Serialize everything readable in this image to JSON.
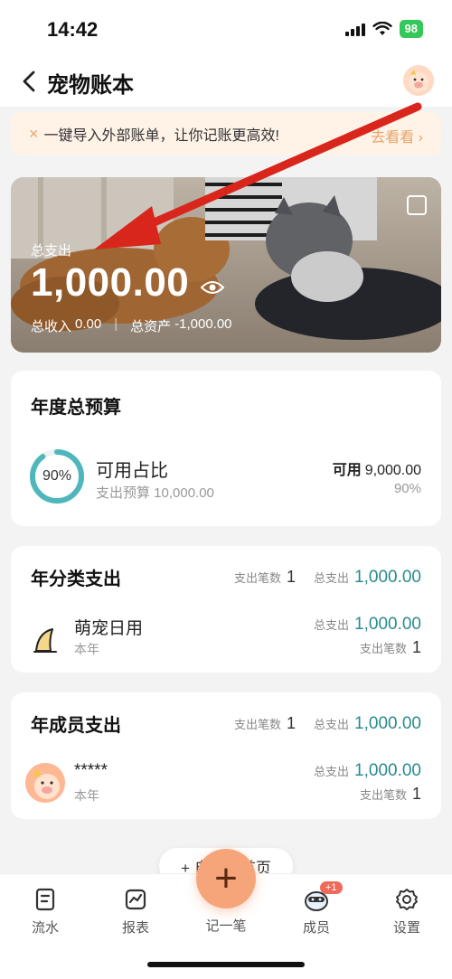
{
  "status": {
    "time": "14:42",
    "battery": "98"
  },
  "header": {
    "title": "宠物账本"
  },
  "import_banner": {
    "close": "×",
    "text": "一键导入外部账单，让你记账更高效!",
    "link": "去看看 ›"
  },
  "hero": {
    "label": "总支出",
    "amount": "1,000.00",
    "income_label": "总收入",
    "income_value": "0.00",
    "assets_label": "总资产",
    "assets_value": "-1,000.00"
  },
  "budget": {
    "title": "年度总预算",
    "percent_text": "90%",
    "percent_value": 0.9,
    "name": "可用占比",
    "sub": "支出预算 10,000.00",
    "available_label": "可用",
    "available_value": "9,000.00",
    "available_percent": "90%"
  },
  "category": {
    "title": "年分类支出",
    "count_label": "支出笔数",
    "count": "1",
    "total_label": "总支出",
    "total": "1,000.00",
    "items": [
      {
        "name": "萌宠日用",
        "period": "本年",
        "total_label": "总支出",
        "total": "1,000.00",
        "count_label": "支出笔数",
        "count": "1"
      }
    ]
  },
  "members": {
    "title": "年成员支出",
    "count_label": "支出笔数",
    "count": "1",
    "total_label": "总支出",
    "total": "1,000.00",
    "items": [
      {
        "name": "*****",
        "period": "本年",
        "total_label": "总支出",
        "total": "1,000.00",
        "count_label": "支出笔数",
        "count": "1"
      }
    ]
  },
  "home_pill": "+ 自定义首页",
  "nav": {
    "items": [
      {
        "label": "流水"
      },
      {
        "label": "报表"
      },
      {
        "label": "记一笔"
      },
      {
        "label": "成员",
        "badge": "+1"
      },
      {
        "label": "设置"
      }
    ]
  },
  "colors": {
    "accent": "#2a8a8e",
    "orange": "#f6a57a",
    "banner": "#fff3e8"
  }
}
